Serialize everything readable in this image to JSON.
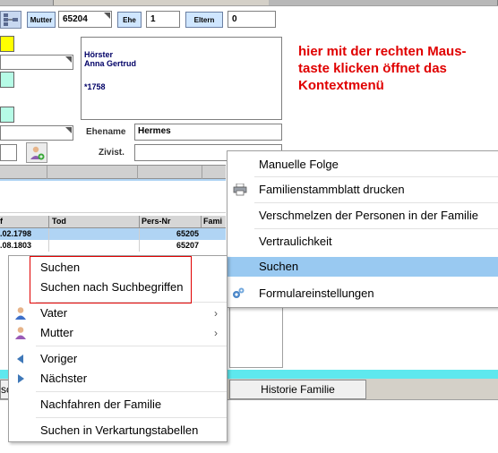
{
  "toolbar": {
    "mutter_label": "Mutter",
    "mutter_value": "65204",
    "ehe_label": "Ehe",
    "ehe_value": "1",
    "eltern_label": "Eltern",
    "eltern_value": "0"
  },
  "person": {
    "lines": [
      "Hörster",
      "Anna Gertrud",
      "",
      "*1758"
    ],
    "ehename_label": "Ehename",
    "ehename_value": "Hermes",
    "zivist_label": "Zivist.",
    "zivist_value": ""
  },
  "hint": {
    "line1": "hier mit der rechten Maus-",
    "line2": "taste klicken öffnet das",
    "line3": "Kontextmenü",
    "color": "#e00000"
  },
  "grid": {
    "headers": [
      "f",
      "Tod",
      "Pers-Nr",
      "Fami"
    ],
    "rows": [
      {
        "c0": ".02.1798",
        "c1": "",
        "c2": "65205",
        "selected": true
      },
      {
        "c0": ".08.1803",
        "c1": "",
        "c2": "65207",
        "selected": false
      }
    ],
    "selected_color": "#b0d4f4"
  },
  "context_menu_right": {
    "items": [
      {
        "label": "Manuelle Folge",
        "icon": ""
      },
      {
        "label": "Familienstammblatt drucken",
        "icon": "printer-icon"
      },
      {
        "label": "Verschmelzen der Personen in der Familie",
        "icon": ""
      },
      {
        "label": "Vertraulichkeit",
        "icon": ""
      },
      {
        "label": "Suchen",
        "icon": "",
        "highlighted": true
      },
      {
        "label": "Formulareinstellungen",
        "icon": "gears-icon"
      }
    ],
    "highlight_color": "#99c9f1"
  },
  "context_menu_left": {
    "items": [
      {
        "label": "Suchen"
      },
      {
        "label": "Suchen nach Suchbegriffen"
      },
      {
        "label": "Vater",
        "icon": "male-person-icon",
        "submenu": true
      },
      {
        "label": "Mutter",
        "icon": "female-person-icon",
        "submenu": true
      },
      {
        "label": "Voriger",
        "icon": "arrow-left-icon"
      },
      {
        "label": "Nächster",
        "icon": "arrow-right-icon"
      },
      {
        "label": "Nachfahren der Familie"
      },
      {
        "label": "Suchen in Verkartungstabellen"
      }
    ],
    "annotation_box_color": "#e00000"
  },
  "tabs": {
    "historie": "Historie Familie",
    "left_fragment": "sc"
  },
  "colors": {
    "yellow_swatch": "#ffff00",
    "teal_swatch": "#b6fbe6",
    "cyan_bar": "#5ee8ee"
  }
}
